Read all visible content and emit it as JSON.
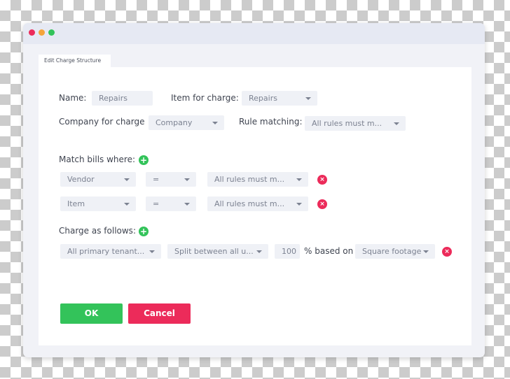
{
  "window": {
    "controls": [
      "close",
      "minimize",
      "maximize"
    ],
    "colors": {
      "close": "#ec2b5a",
      "minimize": "#f5a43a",
      "maximize": "#33c35a"
    }
  },
  "tab": {
    "label": "Edit Charge Structure"
  },
  "form": {
    "name": {
      "label": "Name:",
      "value": "Repairs"
    },
    "item_for_charge": {
      "label": "Item for charge:",
      "value": "Repairs"
    },
    "company_for_charge": {
      "label": "Company for charge",
      "value": "Company"
    },
    "rule_matching": {
      "label": "Rule matching:",
      "value": "All rules must m..."
    },
    "match_bills": {
      "label": "Match bills where:",
      "add_icon": "plus-circle-icon",
      "rules": [
        {
          "field": "Vendor",
          "operator": "=",
          "value": "All rules must m..."
        },
        {
          "field": "Item",
          "operator": "=",
          "value": "All rules must m..."
        }
      ]
    },
    "charge_as_follows": {
      "label": "Charge as follows:",
      "add_icon": "plus-circle-icon",
      "rows": [
        {
          "tenants": "All primary tenant...",
          "split": "Split between all u...",
          "percent": "100",
          "based_on_label": "% based on",
          "basis": "Square footage"
        }
      ]
    }
  },
  "buttons": {
    "ok": "OK",
    "cancel": "Cancel"
  },
  "colors": {
    "accent_green": "#33c35a",
    "accent_red": "#ec2b5a"
  }
}
